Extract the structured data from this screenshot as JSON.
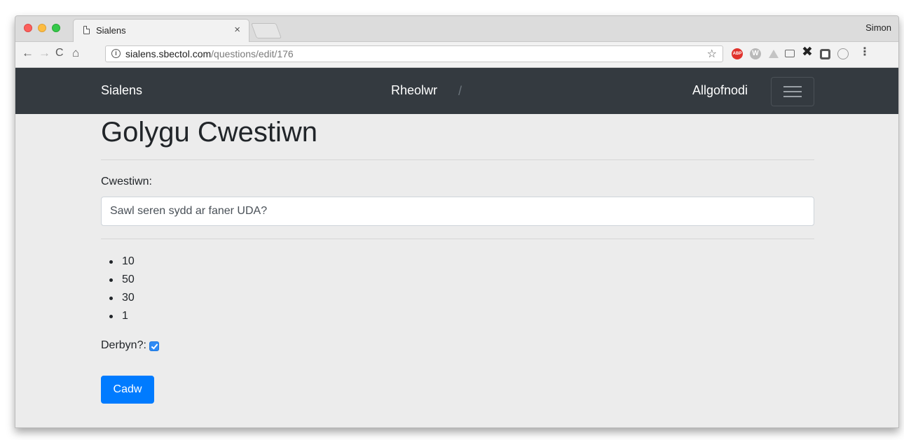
{
  "browser": {
    "tab_title": "Sialens",
    "tab_close": "×",
    "profile_name": "Simon",
    "url_host": "sialens.sbectol.com",
    "url_path": "/questions/edit/176",
    "extensions": [
      "abp-icon",
      "w-icon",
      "drive-icon",
      "cast-icon",
      "x-icon",
      "square-icon",
      "circle-icon"
    ],
    "ext_abp_label": "ABP",
    "ext_w_label": "W"
  },
  "navbar": {
    "brand": "Sialens",
    "admin_link": "Rheolwr",
    "separator": "/",
    "logout_link": "Allgofnodi",
    "bg_color": "#343a40"
  },
  "main": {
    "page_title": "Golygu Cwestiwn",
    "question_label": "Cwestiwn:",
    "question_value": "Sawl seren sydd ar faner UDA?",
    "answers": [
      "10",
      "50",
      "30",
      "1"
    ],
    "accept_label": "Derbyn?:",
    "accept_checked": true,
    "save_label": "Cadw",
    "accent_color": "#007bff"
  }
}
